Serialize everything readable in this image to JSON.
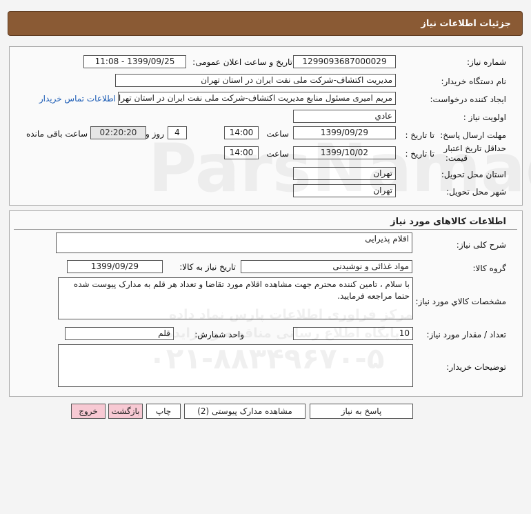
{
  "header": {
    "title": "جزئیات اطلاعات نیاز"
  },
  "info": {
    "need_number_label": "شماره نیاز:",
    "need_number": "1299093687000029",
    "announce_label": "تاریخ و ساعت اعلان عمومی:",
    "announce_value": "1399/09/25 - 11:08",
    "buyer_org_label": "نام دستگاه خریدار:",
    "buyer_org": "مدیریت اکتشاف-شرکت ملی نفت ایران در استان تهران",
    "creator_label": "ایجاد کننده درخواست:",
    "creator": "مریم امیری مسئول منابع مدیریت اکتشاف-شرکت ملی نفت ایران در استان تهران",
    "contact_link": "اطلاعات تماس خریدار",
    "priority_label": "اولویت نیاز :",
    "priority": "عادي",
    "deadline_label": "مهلت ارسال پاسخ:",
    "to_date_label": "تا تاریخ :",
    "deadline_date": "1399/09/29",
    "time_label": "ساعت",
    "deadline_time": "14:00",
    "days_value": "4",
    "days_label": "روز و",
    "remaining_time": "02:20:20",
    "remaining_label": "ساعت باقی مانده",
    "validity_label_1": "حداقل تاریخ اعتبار",
    "validity_label_2": "قیمت:",
    "validity_to_label": "تا تاریخ :",
    "validity_date": "1399/10/02",
    "validity_time_label": "ساعت",
    "validity_time": "14:00",
    "province_label": "استان محل تحویل:",
    "province": "تهران",
    "city_label": "شهر محل تحویل:",
    "city": "تهران"
  },
  "goods": {
    "section_title": "اطلاعات کالاهای مورد نیاز",
    "desc_label": "شرح کلی نیاز:",
    "desc": "اقلام پذیرایی",
    "group_label": "گروه کالا:",
    "group": "مواد غذائی و نوشیدنی",
    "need_date_label": "تاریخ نیاز به کالا:",
    "need_date": "1399/09/29",
    "spec_label": "مشخصات کالاي مورد نياز:",
    "spec": "با سلام ، تامین کننده محترم جهت مشاهده اقلام مورد تقاضا و تعداد هر قلم به مدارک پیوست شده حتما مراجعه فرمایید.",
    "qty_label": "تعداد / مقدار مورد نیاز:",
    "qty": "10",
    "unit_label": "واحد شمارش:",
    "unit": "قلم",
    "notes_label": "توضیحات خریدار:",
    "notes": ""
  },
  "buttons": {
    "reply": "پاسخ به نیاز",
    "attachments": "مشاهده مدارک پیوستی (2)",
    "print": "چاپ",
    "back": "بازگشت",
    "exit": "خروج"
  },
  "watermark": {
    "brand": "ParsNamadData",
    "phone": "۰۲۱-۸۸۳۴۹۶۷۰-۵",
    "line1": "مرکز فراوری اطلاعات پارس نماد داده",
    "line2": "پایگاه اطلاع رسانی مناقصه و مزایده"
  }
}
